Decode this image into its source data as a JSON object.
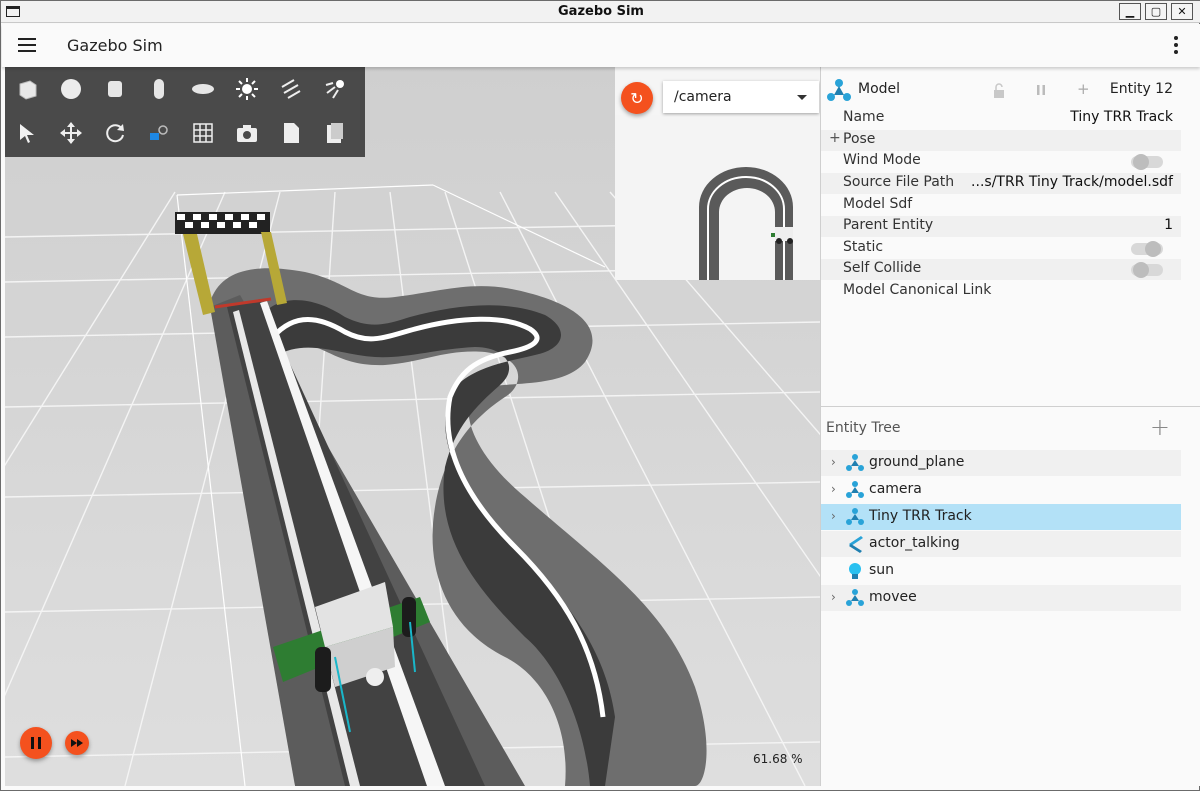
{
  "window": {
    "title": "Gazebo Sim",
    "controls": [
      "minimize",
      "maximize",
      "close"
    ]
  },
  "appbar": {
    "title": "Gazebo Sim",
    "menu_icon": "hamburger-icon",
    "overflow_icon": "kebab-menu-icon"
  },
  "toolbar": {
    "shapes": [
      "box-icon",
      "sphere-icon",
      "cylinder-icon",
      "capsule-icon",
      "ellipsoid-icon",
      "sun-light-icon",
      "directional-light-icon",
      "spot-light-icon"
    ],
    "tools": [
      "select-icon",
      "translate-icon",
      "rotate-icon",
      "transform-mode-icon",
      "grid-snap-icon",
      "screenshot-icon",
      "copy-icon",
      "paste-icon"
    ]
  },
  "camera_view": {
    "topic": "/camera"
  },
  "playback": {
    "real_time_factor": "61.68 %"
  },
  "component_inspector": {
    "title": "Model",
    "entity": "Entity 12",
    "properties": [
      {
        "key": "Name",
        "value": "Tiny TRR Track"
      },
      {
        "key": "Pose",
        "value": "",
        "expandable": true
      },
      {
        "key": "Wind Mode",
        "value": "",
        "toggle": "off"
      },
      {
        "key": "Source File Path",
        "value": "...s/TRR Tiny Track/model.sdf"
      },
      {
        "key": "Model Sdf",
        "value": ""
      },
      {
        "key": "Parent Entity",
        "value": "1"
      },
      {
        "key": "Static",
        "value": "",
        "toggle": "on"
      },
      {
        "key": "Self Collide",
        "value": "",
        "toggle": "off"
      },
      {
        "key": "Model Canonical Link",
        "value": ""
      }
    ]
  },
  "entity_tree": {
    "title": "Entity Tree",
    "items": [
      {
        "label": "ground_plane",
        "icon": "model-icon",
        "expandable": true,
        "selected": false
      },
      {
        "label": "camera",
        "icon": "model-icon",
        "expandable": true,
        "selected": false
      },
      {
        "label": "Tiny TRR Track",
        "icon": "model-icon",
        "expandable": true,
        "selected": true
      },
      {
        "label": "actor_talking",
        "icon": "actor-icon",
        "expandable": false,
        "selected": false
      },
      {
        "label": "sun",
        "icon": "light-bulb-icon",
        "expandable": false,
        "selected": false
      },
      {
        "label": "movee",
        "icon": "model-icon",
        "expandable": true,
        "selected": false
      }
    ]
  },
  "colors": {
    "accent": "#f4511e",
    "selection": "#b3e1f7",
    "toolbar": "#4a4a4a",
    "model_icon": "#29a3d8"
  }
}
